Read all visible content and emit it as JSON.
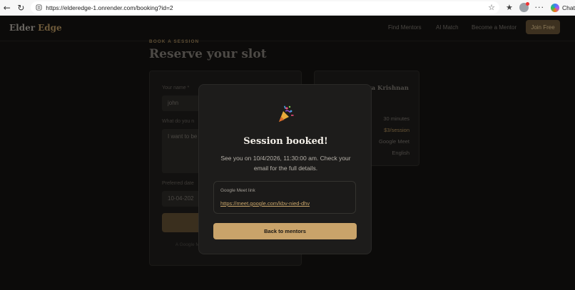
{
  "browser": {
    "url": "https://elderedge-1.onrender.com/booking?id=2",
    "chat_label": "Chat"
  },
  "header": {
    "brand_part1": "Elder",
    "brand_part2": "Edge",
    "nav": [
      "Find Mentors",
      "AI Match",
      "Become a Mentor"
    ],
    "join_label": "Join Free"
  },
  "booking": {
    "eyebrow": "BOOK A SESSION",
    "title": "Reserve your slot",
    "name_label": "Your name *",
    "name_value": "john",
    "topic_label": "What do you n",
    "topic_value": "I want to be",
    "date_label": "Preferred date",
    "date_value": "10-04-202",
    "note": "A Google Meet link will be sent to your email after confirmation."
  },
  "mentor": {
    "name": "ya Krishnan",
    "duration": "30 minutes",
    "price": "$3/session",
    "platform": "Google Meet",
    "language": "English"
  },
  "modal": {
    "title": "Session booked!",
    "message": "See you on 10/4/2026, 11:30:00 am. Check your email for the full details.",
    "meet_label": "Google Meet link",
    "meet_link": "https://meet.google.com/kbv-nied-dhv",
    "back_label": "Back to mentors"
  }
}
